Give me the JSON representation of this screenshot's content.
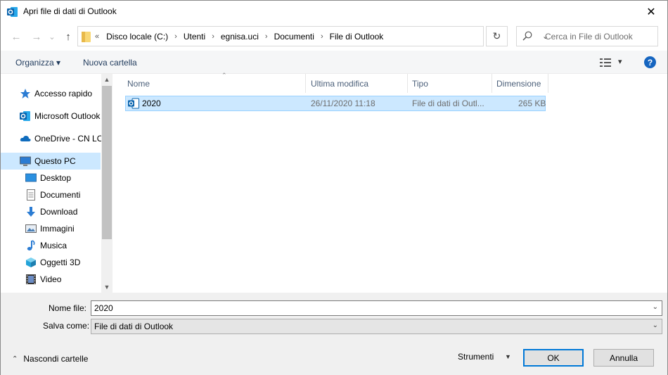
{
  "window": {
    "title": "Apri file di dati di Outlook",
    "close_glyph": "✕"
  },
  "nav": {
    "back_glyph": "←",
    "forward_glyph": "→",
    "recent_glyph": "⌄",
    "up_glyph": "↑",
    "path_overflow": "«",
    "breadcrumbs": [
      "Disco locale (C:)",
      "Utenti",
      "egnisa.uci",
      "Documenti",
      "File di Outlook"
    ],
    "breadcrumb_sep": "›",
    "dropdown_glyph": "⌄",
    "refresh_glyph": "↻",
    "search_placeholder": "Cerca in File di Outlook"
  },
  "toolbar": {
    "organize": "Organizza ▾",
    "new_folder": "Nuova cartella",
    "views_arrow": "▾",
    "help": "?"
  },
  "sidebar": {
    "items": [
      {
        "label": "Accesso rapido",
        "icon": "star-icon",
        "level": 0
      },
      {
        "label": "Microsoft Outlook",
        "icon": "outlook-icon",
        "level": 0
      },
      {
        "label": "OneDrive - CN LO",
        "icon": "cloud-icon",
        "level": 0
      },
      {
        "label": "Questo PC",
        "icon": "computer-icon",
        "level": 0,
        "selected": true
      },
      {
        "label": "Desktop",
        "icon": "desktop-icon",
        "level": 1
      },
      {
        "label": "Documenti",
        "icon": "document-icon",
        "level": 1
      },
      {
        "label": "Download",
        "icon": "download-icon",
        "level": 1
      },
      {
        "label": "Immagini",
        "icon": "pictures-icon",
        "level": 1
      },
      {
        "label": "Musica",
        "icon": "music-icon",
        "level": 1
      },
      {
        "label": "Oggetti 3D",
        "icon": "cube-icon",
        "level": 1
      },
      {
        "label": "Video",
        "icon": "video-icon",
        "level": 1
      }
    ],
    "scroll_up": "▲",
    "scroll_down": "▼"
  },
  "columns": {
    "name": "Nome",
    "modified": "Ultima modifica",
    "type": "Tipo",
    "size": "Dimensione",
    "sort_glyph": "⌃"
  },
  "files": [
    {
      "name": "2020",
      "modified": "26/11/2020 11:18",
      "type": "File di dati di Outl...",
      "size": "265 KB"
    }
  ],
  "bottom": {
    "file_name_label": "Nome file:",
    "file_name_value": "2020",
    "save_as_label": "Salva come:",
    "save_as_value": "File di dati di Outlook",
    "combo_arrow": "⌄",
    "hide_folders_glyph": "⌃",
    "hide_folders": "Nascondi cartelle",
    "tools": "Strumenti",
    "tools_arrow": "▼",
    "ok": "OK",
    "cancel": "Annulla"
  },
  "colors": {
    "selection": "#cce8ff",
    "accent": "#0078d7",
    "outlook_blue": "#0a64ad"
  }
}
